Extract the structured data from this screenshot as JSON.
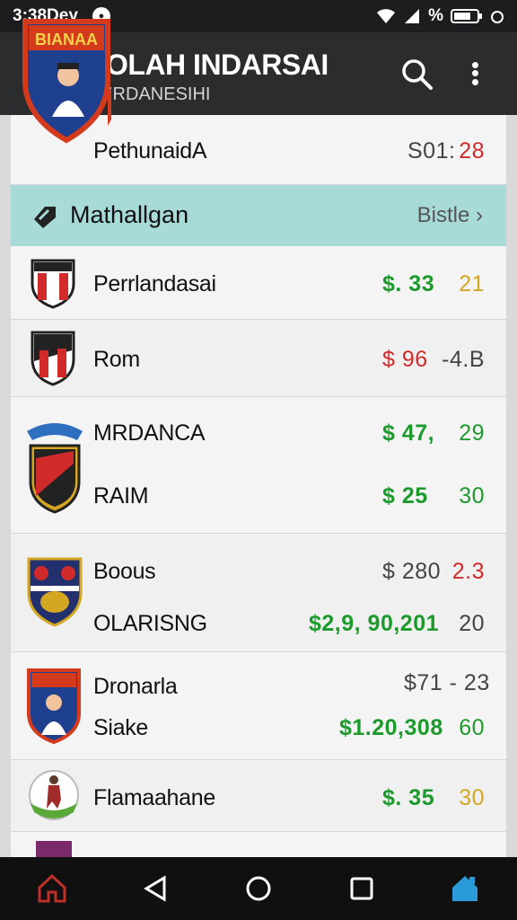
{
  "status_bar": {
    "time": "3:38Dey",
    "battery": "%"
  },
  "app": {
    "title": "OLAH INDARSAI",
    "subtitle": "IRDANESIHI",
    "logo_text": "BIANAA"
  },
  "top_row": {
    "name": "PethunaidA",
    "amount_a": "S01:",
    "amount_b": "28"
  },
  "section": {
    "label": "Mathallgan",
    "action": "Bistle"
  },
  "rows": [
    {
      "name": "Perrlandasai",
      "amount": "$. 33",
      "change": "21"
    },
    {
      "name": "Rom",
      "amount": "$ 96",
      "change": "-4.B"
    },
    {
      "name": "MRDANCA",
      "amount": "$ 47,",
      "change": "29"
    },
    {
      "name": "RAIM",
      "amount": "$ 25",
      "change": "30"
    },
    {
      "name": "Boous",
      "amount": "$ 280",
      "change": "2.3"
    },
    {
      "name": "OLARISNG",
      "amount": "$2,9, 90,201",
      "change": "20"
    },
    {
      "name": "Dronarla",
      "amount": "$71 - 23",
      "change": ""
    },
    {
      "name": "Siake",
      "amount": "$1.20,308",
      "change": "60"
    },
    {
      "name": "Flamaahane",
      "amount": "$. 35",
      "change": "30"
    }
  ],
  "colors": {
    "accent_green": "#1c9a2c",
    "accent_red": "#d12a2a",
    "header": "#2b2c2d",
    "section": "#a8dad8"
  }
}
